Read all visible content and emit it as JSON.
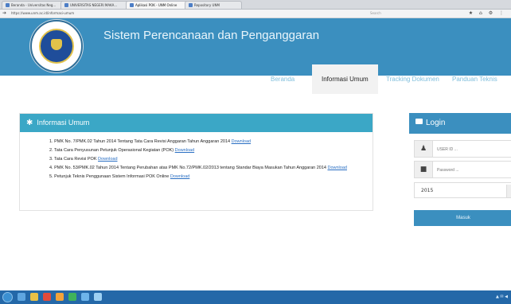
{
  "browser": {
    "tabs": [
      {
        "label": "Beranda - Universitas Neg..."
      },
      {
        "label": "UNIVERSITAS NEGERI MAKA..."
      },
      {
        "label": "Aplikasi POK - UNM Online"
      },
      {
        "label": "Repository UNM"
      }
    ],
    "active_tab_index": 2,
    "url": "https://www.unm.ac.id/informasi-umum",
    "search_placeholder": "Search",
    "nav_icon": "arrow-right-icon",
    "toolbar_icons": "★ ⌂ ⚙ ⋮"
  },
  "site": {
    "title": "Sistem Perencanaan dan Penganggaran",
    "logo_icon": "university-seal-icon",
    "nav": [
      {
        "label": "Beranda"
      },
      {
        "label": "Informasi Umum"
      },
      {
        "label": "Tracking Dokumen"
      },
      {
        "label": "Panduan Teknis"
      }
    ],
    "active_nav": "Informasi Umum"
  },
  "info": {
    "heading": "Informasi Umum",
    "heading_icon": "asterisk-icon",
    "items": [
      {
        "text": "1. PMK No. 7/PMK.02 Tahun 2014 Tentang Tata Cara Revisi Anggaran Tahun Anggaran 2014",
        "link": "Download"
      },
      {
        "text": "2. Tata Cara Penyusunan Petunjuk Operasional Kegiatan (POK)",
        "link": "Download"
      },
      {
        "text": "3. Tata Cara Revisi POK",
        "link": "Download"
      },
      {
        "text": "4. PMK No. 53/PMK.02 Tahun 2014 Tentang Perubahan atas PMK No.72/PMK.02/2013 tentang Standar Biaya Masukan Tahun Anggaran 2014",
        "link": "Download"
      },
      {
        "text": "5. Petunjuk Teknis Penggunaan Sistem Informasi POK Online",
        "link": "Download"
      }
    ]
  },
  "login": {
    "heading": "Login",
    "heading_icon": "lock-icon",
    "user_icon": "user-icon",
    "password_icon": "lock-icon",
    "user_placeholder": "USER ID ...",
    "password_placeholder": "Password ...",
    "year": "2015",
    "submit_label": "Masuk"
  },
  "taskbar": {
    "tray_text": "▲ ✉ ◀"
  },
  "colors": {
    "header_bg": "#3b8fbf",
    "panel_header": "#3ba7c6",
    "link": "#2a6fc3",
    "taskbar": "#2468a8"
  }
}
